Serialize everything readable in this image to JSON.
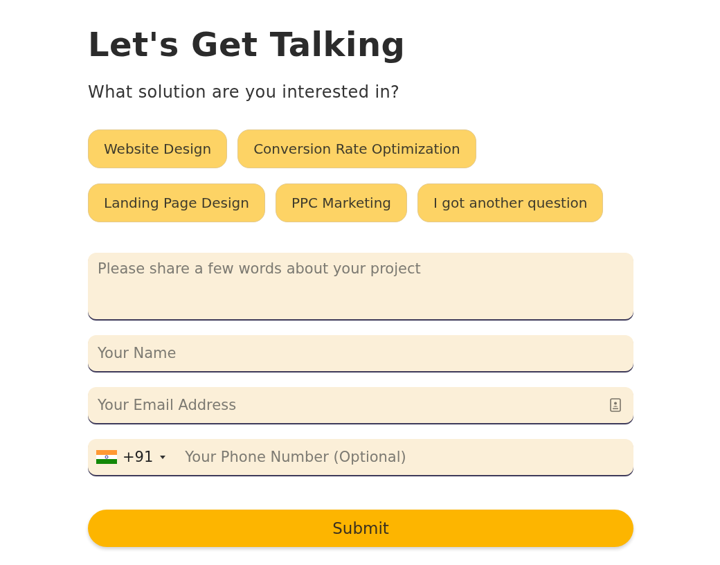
{
  "heading": "Let's Get Talking",
  "question": "What solution are you interested in?",
  "options": [
    {
      "label": "Website Design",
      "selected": false
    },
    {
      "label": "Conversion Rate Optimization",
      "selected": false
    },
    {
      "label": "Landing Page Design",
      "selected": false
    },
    {
      "label": "PPC Marketing",
      "selected": false
    },
    {
      "label": "I got another question",
      "selected": false
    }
  ],
  "fields": [
    {
      "kind": "textarea",
      "placeholder": "Please share a few words about your project"
    },
    {
      "kind": "text",
      "placeholder": "Your Name"
    },
    {
      "kind": "email",
      "placeholder": "Your Email Address"
    },
    {
      "kind": "phone",
      "country_code": "+91",
      "placeholder": "Your Phone Number (Optional)"
    }
  ],
  "submit": "Submit"
}
